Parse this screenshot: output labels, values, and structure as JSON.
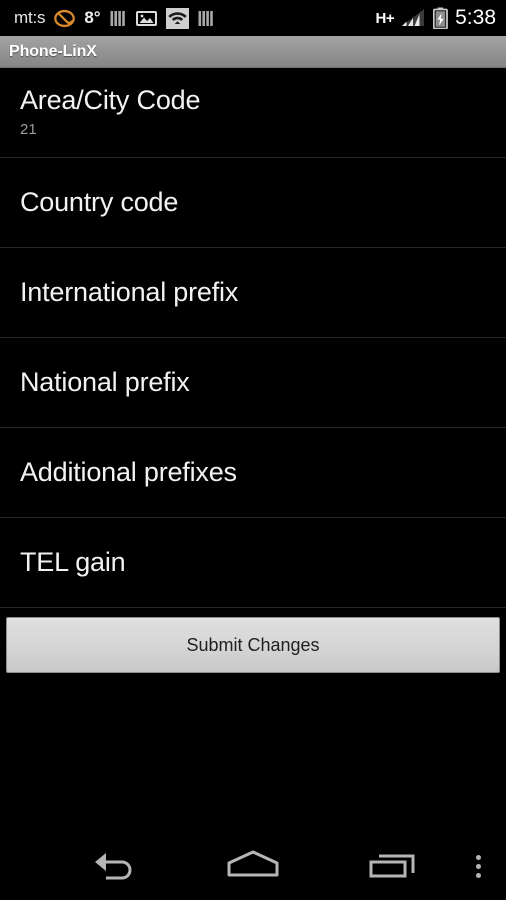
{
  "status_bar": {
    "carrier": "mt:s",
    "temperature": "8°",
    "network_type": "H+",
    "clock": "5:38",
    "icons": [
      {
        "name": "call-forwarding-icon"
      },
      {
        "name": "signal-bars-icon"
      },
      {
        "name": "image-gallery-icon"
      },
      {
        "name": "wifi-icon"
      },
      {
        "name": "signal-bars-icon-2"
      },
      {
        "name": "cellular-signal-icon"
      },
      {
        "name": "battery-charging-icon"
      }
    ],
    "colors": {
      "background": "#000000",
      "accent_orange": "#d99030",
      "text": "#ffffff"
    }
  },
  "title_bar": {
    "title": "Phone-LinX",
    "colors": {
      "gradient_top": "#a3a3a3",
      "gradient_bottom": "#868686",
      "text": "#ffffff"
    }
  },
  "preferences": {
    "items": [
      {
        "title": "Area/City Code",
        "value": "21"
      },
      {
        "title": "Country code",
        "value": ""
      },
      {
        "title": "International prefix",
        "value": ""
      },
      {
        "title": "National prefix",
        "value": ""
      },
      {
        "title": "Additional prefixes",
        "value": ""
      },
      {
        "title": "TEL gain",
        "value": ""
      }
    ]
  },
  "actions": {
    "submit_label": "Submit Changes"
  },
  "navigation_bar": {
    "back_label": "Back",
    "home_label": "Home",
    "recents_label": "Recent apps",
    "menu_label": "More options"
  }
}
